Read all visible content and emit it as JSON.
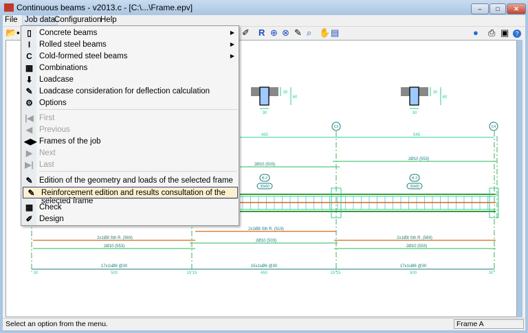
{
  "window": {
    "title": "Continuous beams - v2013.c - [C:\\...\\Frame.epv]",
    "minimize": "–",
    "maximize": "□",
    "close": "✕"
  },
  "menubar": [
    {
      "label": "File"
    },
    {
      "label": "Job data"
    },
    {
      "label": "Configuration"
    },
    {
      "label": "Help"
    }
  ],
  "job_data_menu": {
    "items": [
      {
        "label": "Concrete beams",
        "icon": "concrete-beam-icon",
        "glyph": "▯",
        "submenu": true,
        "enabled": true
      },
      {
        "label": "Rolled steel beams",
        "icon": "i-beam-icon",
        "glyph": "I",
        "submenu": true,
        "enabled": true
      },
      {
        "label": "Cold-formed steel beams",
        "icon": "c-section-icon",
        "glyph": "C",
        "submenu": true,
        "enabled": true
      },
      {
        "label": "Combinations",
        "icon": "combinations-icon",
        "glyph": "▦",
        "enabled": true
      },
      {
        "label": "Loadcase",
        "icon": "loadcase-icon",
        "glyph": "⬇",
        "enabled": true
      },
      {
        "label": "Loadcase consideration for deflection calculation",
        "icon": "deflection-icon",
        "glyph": "✎",
        "enabled": true
      },
      {
        "label": "Options",
        "icon": "options-icon",
        "glyph": "⚙",
        "enabled": true
      },
      {
        "label": "First",
        "icon": "first-icon",
        "glyph": "|◀",
        "enabled": false
      },
      {
        "label": "Previous",
        "icon": "previous-icon",
        "glyph": "◀",
        "enabled": false
      },
      {
        "label": "Frames of the job",
        "icon": "frames-icon",
        "glyph": "◀▶",
        "enabled": true
      },
      {
        "label": "Next",
        "icon": "next-icon",
        "glyph": "▶",
        "enabled": false
      },
      {
        "label": "Last",
        "icon": "last-icon",
        "glyph": "▶|",
        "enabled": false
      },
      {
        "label": "Edition of the geometry and loads of the selected frame",
        "icon": "geometry-edit-icon",
        "glyph": "✎",
        "enabled": true
      },
      {
        "label": "Reinforcement edition and results consultation of the selected frame",
        "icon": "reinforcement-edit-icon",
        "glyph": "✎",
        "enabled": true,
        "highlighted": true
      },
      {
        "label": "Check",
        "icon": "check-icon",
        "glyph": "▦",
        "enabled": true
      },
      {
        "label": "Design",
        "icon": "design-icon",
        "glyph": "✐",
        "enabled": true
      }
    ]
  },
  "toolbar": {
    "left": [
      {
        "icon": "open-folder-icon",
        "glyph": "📂"
      },
      {
        "icon": "save-icon",
        "glyph": "▪"
      }
    ],
    "right": [
      {
        "icon": "pen-icon",
        "glyph": "✐"
      },
      {
        "icon": "redraw-icon",
        "glyph": "R"
      },
      {
        "icon": "zoom-all-icon",
        "glyph": "⊕"
      },
      {
        "icon": "zoom-x2-icon",
        "glyph": "⊗"
      },
      {
        "icon": "pencil-icon",
        "glyph": "✎"
      },
      {
        "icon": "zoom-window-icon",
        "glyph": "⌕"
      },
      {
        "icon": "pan-hand-icon",
        "glyph": "✋"
      },
      {
        "icon": "print-preview-icon",
        "glyph": "▤"
      },
      {
        "icon": "globe-icon",
        "glyph": "●"
      },
      {
        "icon": "printer-icon",
        "glyph": "⎙"
      },
      {
        "icon": "export-icon",
        "glyph": "▣"
      },
      {
        "icon": "help-icon",
        "glyph": "?"
      }
    ]
  },
  "drawing": {
    "columns": [
      "C3",
      "C4"
    ],
    "spans": [
      "450",
      "545"
    ],
    "sections": [
      {
        "width": "30",
        "flange": "30",
        "depth": "60"
      },
      {
        "width": "30",
        "flange": "30",
        "depth": "60"
      }
    ],
    "beams": [
      {
        "name": "B-2",
        "size": "30x60"
      },
      {
        "name": "B-3",
        "size": "30x60"
      }
    ],
    "top_bars": [
      {
        "label": "2Ø10 (503)"
      },
      {
        "label": "2Ø10 (553)"
      }
    ],
    "bottom_bars": {
      "orange_mid": "2x1Ø8 Sth R. (519)",
      "orange_left": "2x1Ø8 Sth R. (569)",
      "orange_right": "2x1Ø8 Sth R. (569)",
      "green_left": "2Ø10 (553)",
      "green_mid": "2Ø10 (503)",
      "green_right": "2Ø10 (553)"
    },
    "stirrups": [
      "17x1sØ6 @30",
      "15x1sØ6 @30",
      "17x1sØ6 @30"
    ],
    "dims": [
      "30",
      "500",
      "15 15",
      "450",
      "15 15",
      "500",
      "30"
    ]
  },
  "colors": {
    "green": "#2ecc8f",
    "dark_green": "#3a9b3a",
    "orange": "#d2691e",
    "blue_stirrup": "#8ec1f5",
    "teal": "#177a7a"
  },
  "status": {
    "message": "Select an option from the menu.",
    "frame": "Frame A"
  }
}
